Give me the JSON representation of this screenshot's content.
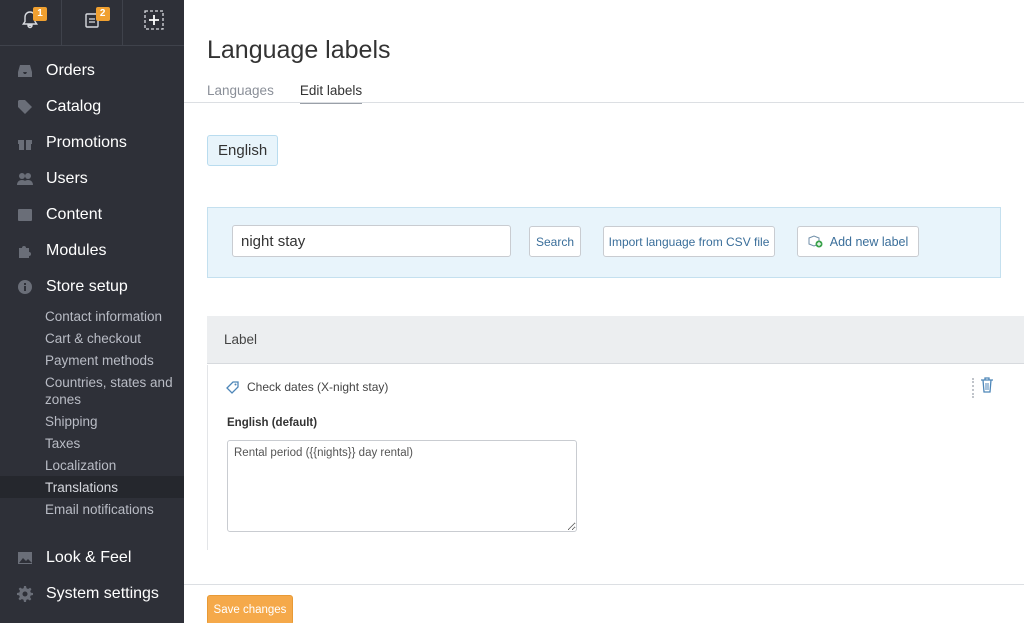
{
  "topbar": {
    "notifications_count": "1",
    "orders_count": "2"
  },
  "sidebar": {
    "items": [
      {
        "label": "Orders",
        "icon": "inbox-icon"
      },
      {
        "label": "Catalog",
        "icon": "tag-icon"
      },
      {
        "label": "Promotions",
        "icon": "gift-icon"
      },
      {
        "label": "Users",
        "icon": "users-icon"
      },
      {
        "label": "Content",
        "icon": "content-icon"
      },
      {
        "label": "Modules",
        "icon": "puzzle-icon"
      },
      {
        "label": "Store setup",
        "icon": "info-icon"
      }
    ],
    "subitems": [
      "Contact information",
      "Cart & checkout",
      "Payment methods",
      "Countries, states and zones",
      "Shipping",
      "Taxes",
      "Localization",
      "Translations",
      "Email notifications"
    ],
    "active_subitem": "Translations",
    "bottom_items": [
      {
        "label": "Look & Feel",
        "icon": "image-icon"
      },
      {
        "label": "System settings",
        "icon": "gear-icon"
      }
    ]
  },
  "main": {
    "title": "Language labels",
    "tabs": [
      {
        "label": "Languages",
        "active": false
      },
      {
        "label": "Edit labels",
        "active": true
      }
    ],
    "language_chip": "English",
    "search": {
      "value": "night stay",
      "search_button": "Search",
      "import_button": "Import language from CSV file",
      "add_button": "Add new label"
    },
    "table": {
      "header": "Label",
      "rows": [
        {
          "name": "Check dates (X-night stay)",
          "language_label": "English (default)",
          "value": "Rental period ({{nights}} day rental)"
        }
      ]
    },
    "save_button": "Save changes"
  },
  "colors": {
    "sidebar_bg": "#2e3038",
    "accent_orange": "#f5a94a",
    "panel_blue": "#e8f4fb",
    "link_blue": "#3a6e9a"
  }
}
